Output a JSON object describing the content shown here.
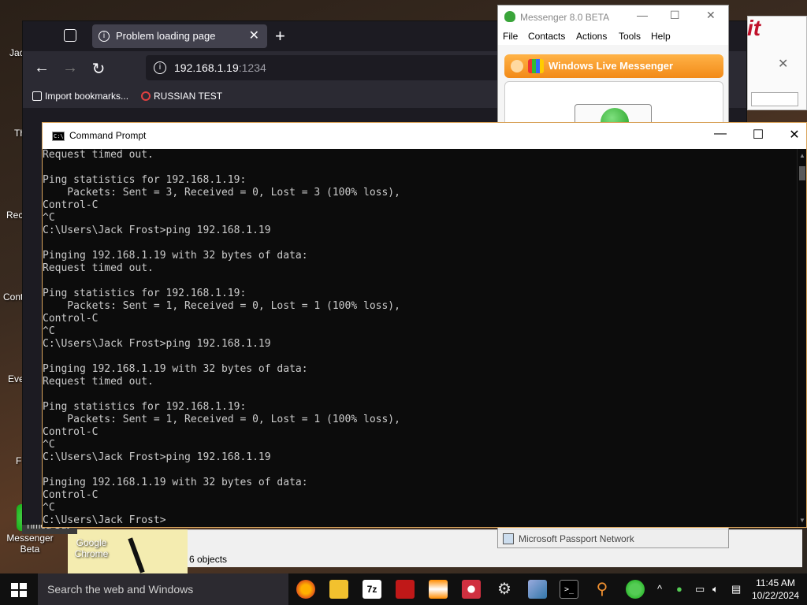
{
  "desktop": {
    "icons": [
      {
        "label": "Messenger Beta"
      },
      {
        "label": "Google Chrome"
      }
    ],
    "partial_labels": [
      "Jac",
      "Th",
      "Rec",
      "Cont",
      "Eve",
      "F"
    ],
    "tooltip": "Timed Out"
  },
  "browser": {
    "tab_title": "Problem loading page",
    "url_host": "192.168.1.19",
    "url_port": ":1234",
    "bookmarks": [
      {
        "label": "Import bookmarks...",
        "icon": "import-icon"
      },
      {
        "label": "RUSSIAN TEST",
        "icon": "search-icon"
      }
    ]
  },
  "messenger": {
    "title": "Messenger 8.0 BETA",
    "menu": [
      "File",
      "Contacts",
      "Actions",
      "Tools",
      "Help"
    ],
    "banner": "Windows Live Messenger",
    "status": "Microsoft Passport Network"
  },
  "explorer": {
    "status": "6 objects"
  },
  "cmd": {
    "title": "Command Prompt",
    "lines": [
      "Request timed out.",
      "",
      "Ping statistics for 192.168.1.19:",
      "    Packets: Sent = 3, Received = 0, Lost = 3 (100% loss),",
      "Control-C",
      "^C",
      "C:\\Users\\Jack Frost>ping 192.168.1.19",
      "",
      "Pinging 192.168.1.19 with 32 bytes of data:",
      "Request timed out.",
      "",
      "Ping statistics for 192.168.1.19:",
      "    Packets: Sent = 1, Received = 0, Lost = 1 (100% loss),",
      "Control-C",
      "^C",
      "C:\\Users\\Jack Frost>ping 192.168.1.19",
      "",
      "Pinging 192.168.1.19 with 32 bytes of data:",
      "Request timed out.",
      "",
      "Ping statistics for 192.168.1.19:",
      "    Packets: Sent = 1, Received = 0, Lost = 1 (100% loss),",
      "Control-C",
      "^C",
      "C:\\Users\\Jack Frost>ping 192.168.1.19",
      "",
      "Pinging 192.168.1.19 with 32 bytes of data:",
      "Control-C",
      "^C",
      "C:\\Users\\Jack Frost>"
    ]
  },
  "taskbar": {
    "search_placeholder": "Search the web and Windows",
    "apps": [
      "firefox-icon",
      "file-explorer-icon",
      "7zip-icon",
      "app-red-icon",
      "vlc-icon",
      "app-gear-red-icon",
      "settings-icon",
      "app-blue-icon",
      "command-prompt-icon",
      "search-magnifier-icon",
      "messenger-icon"
    ],
    "clock_time": "11:45 AM",
    "clock_date": "10/22/2024"
  }
}
